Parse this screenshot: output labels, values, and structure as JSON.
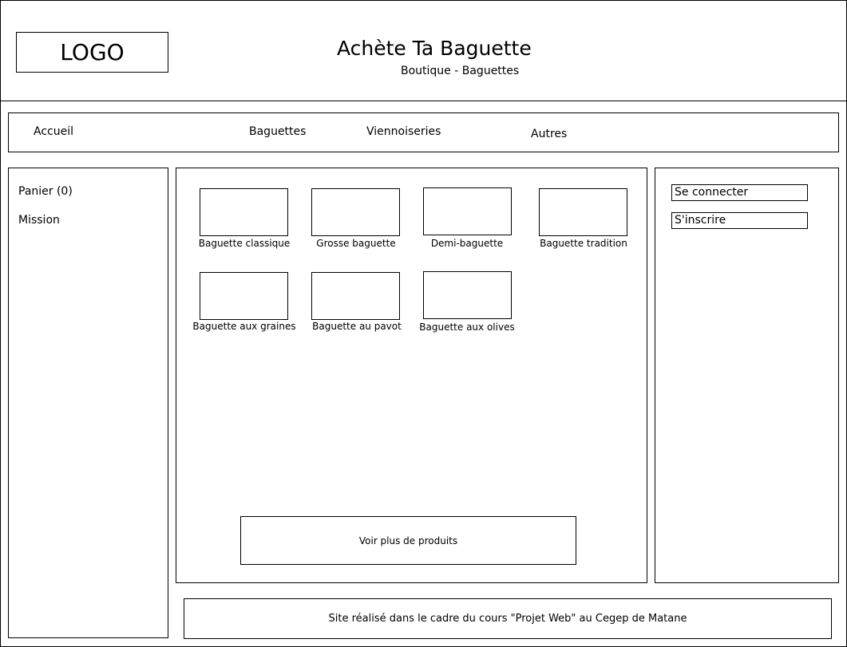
{
  "header": {
    "logo": "LOGO",
    "title": "Achète Ta Baguette",
    "subtitle": "Boutique - Baguettes"
  },
  "nav": {
    "items": [
      "Accueil",
      "Baguettes",
      "Viennoiseries",
      "Autres"
    ]
  },
  "sidebar_left": {
    "cart": "Panier (0)",
    "mission": "Mission"
  },
  "products": [
    {
      "name": "Baguette classique"
    },
    {
      "name": "Grosse baguette"
    },
    {
      "name": "Demi-baguette"
    },
    {
      "name": "Baguette tradition"
    },
    {
      "name": "Baguette aux graines"
    },
    {
      "name": "Baguette au pavot"
    },
    {
      "name": "Baguette aux olives"
    }
  ],
  "more_button": "Voir plus de produits",
  "sidebar_right": {
    "login": "Se connecter",
    "signup": "S'inscrire"
  },
  "footer": "Site réalisé dans le cadre du cours \"Projet Web\" au Cegep de Matane"
}
